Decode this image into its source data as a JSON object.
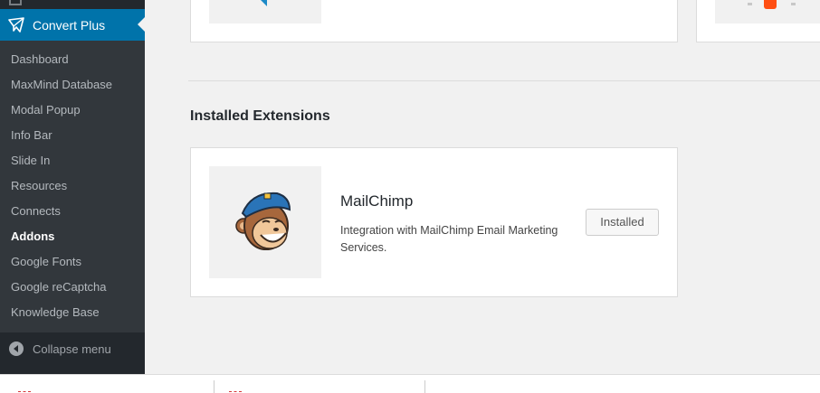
{
  "sidebar": {
    "plugin_title": "Convert Plus",
    "items": [
      {
        "label": "Dashboard",
        "current": false
      },
      {
        "label": "MaxMind Database",
        "current": false
      },
      {
        "label": "Modal Popup",
        "current": false
      },
      {
        "label": "Info Bar",
        "current": false
      },
      {
        "label": "Slide In",
        "current": false
      },
      {
        "label": "Resources",
        "current": false
      },
      {
        "label": "Connects",
        "current": false
      },
      {
        "label": "Addons",
        "current": true
      },
      {
        "label": "Google Fonts",
        "current": false
      },
      {
        "label": "Google reCaptcha",
        "current": false
      },
      {
        "label": "Knowledge Base",
        "current": false
      }
    ],
    "collapse_label": "Collapse menu"
  },
  "main": {
    "section_title": "Installed Extensions",
    "installed_extension": {
      "name": "MailChimp",
      "description": "Integration with MailChimp Email Marketing Services.",
      "button_label": "Installed"
    }
  },
  "icons": {
    "plugin": "convert-plus-icon",
    "collapse": "collapse-arrow-icon",
    "extension_logo": "mailchimp-logo-icon"
  },
  "colors": {
    "sidebar_bg": "#23282d",
    "submenu_bg": "#32373c",
    "accent": "#0073aa",
    "page_bg": "#f1f1f1"
  }
}
